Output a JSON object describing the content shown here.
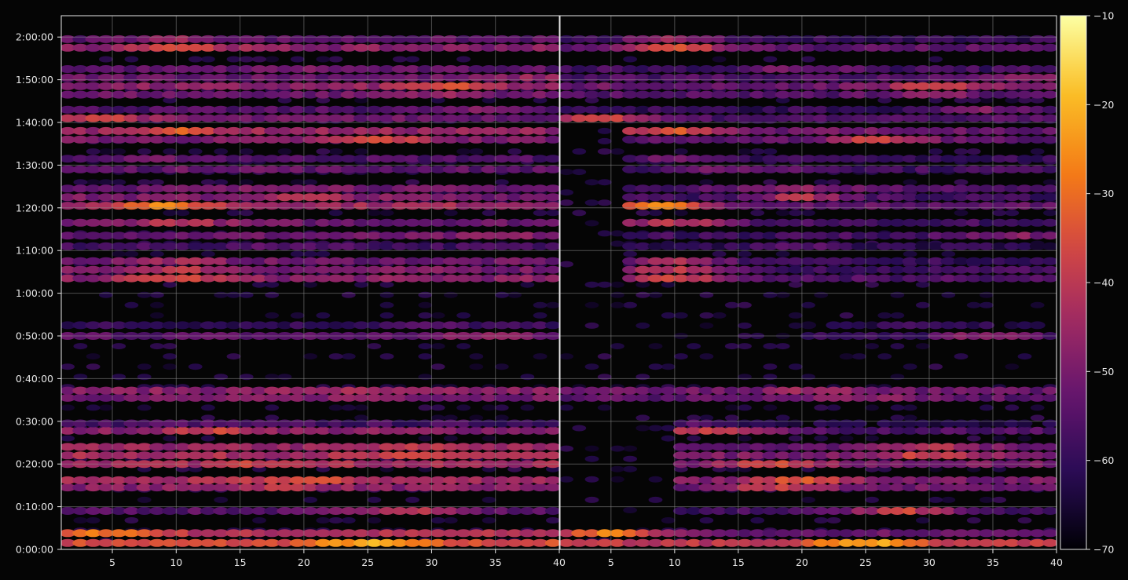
{
  "chart_data": {
    "type": "heatmap",
    "background": "#050505",
    "grid": true,
    "grid_color": "#8a8a8a",
    "panels": [
      {
        "name": "left",
        "x_tick_labels": [
          "5",
          "10",
          "15",
          "20",
          "25",
          "30",
          "35",
          "40"
        ],
        "xlim": [
          1,
          40
        ]
      },
      {
        "name": "right",
        "x_tick_labels": [
          "5",
          "10",
          "15",
          "20",
          "25",
          "30",
          "35",
          "40"
        ],
        "xlim": [
          1,
          40
        ]
      }
    ],
    "y_tick_labels": [
      "0:00:00",
      "0:10:00",
      "0:20:00",
      "0:30:00",
      "0:40:00",
      "0:50:00",
      "1:00:00",
      "1:10:00",
      "1:20:00",
      "1:30:00",
      "1:40:00",
      "1:50:00",
      "2:00:00"
    ],
    "ylim_minutes": [
      0,
      125
    ],
    "colorbar": {
      "colormap": "inferno",
      "range": [
        -70,
        -10
      ],
      "tick_labels": [
        "−10",
        "−20",
        "−30",
        "−40",
        "−50",
        "−60",
        "−70"
      ],
      "tick_values": [
        -10,
        -20,
        -30,
        -40,
        -50,
        -60,
        -70
      ]
    },
    "bands": [
      {
        "minute": 1.5,
        "left": -36,
        "right": -40,
        "peak_x": 25,
        "peak": -22
      },
      {
        "minute": 3.8,
        "left": -42,
        "right": -52,
        "peak_x": 5,
        "peak": -28
      },
      {
        "minute": 9.0,
        "left": -55,
        "right": -58,
        "peak_x": 28,
        "peak": -38
      },
      {
        "minute": 14.5,
        "left": -48,
        "right": -52,
        "peak_x": 18,
        "peak": -40
      },
      {
        "minute": 16.2,
        "left": -44,
        "right": -50,
        "peak_x": 20,
        "peak": -35
      },
      {
        "minute": 20.0,
        "left": -44,
        "right": -50,
        "peak_x": 18,
        "peak": -36
      },
      {
        "minute": 22.0,
        "left": -43,
        "right": -50,
        "peak_x": 30,
        "peak": -38
      },
      {
        "minute": 24.0,
        "left": -46,
        "right": -52,
        "peak_x": 30,
        "peak": -40
      },
      {
        "minute": 27.8,
        "left": -48,
        "right": -56,
        "peak_x": 13,
        "peak": -38
      },
      {
        "minute": 29.5,
        "left": -58,
        "right": -64,
        "peak_x": 10,
        "peak": -55
      },
      {
        "minute": 35.5,
        "left": -50,
        "right": -54,
        "peak_x": 25,
        "peak": -46
      },
      {
        "minute": 37.2,
        "left": -48,
        "right": -52,
        "peak_x": 22,
        "peak": -44
      },
      {
        "minute": 50.0,
        "left": -54,
        "right": -60,
        "peak_x": 35,
        "peak": -46
      },
      {
        "minute": 52.5,
        "left": -60,
        "right": -66,
        "peak_x": 30,
        "peak": -56
      },
      {
        "minute": 63.5,
        "left": -48,
        "right": -56,
        "peak_x": 10,
        "peak": -36
      },
      {
        "minute": 65.5,
        "left": -50,
        "right": -58,
        "peak_x": 10,
        "peak": -40
      },
      {
        "minute": 67.5,
        "left": -52,
        "right": -60,
        "peak_x": 10,
        "peak": -44
      },
      {
        "minute": 71.0,
        "left": -58,
        "right": -62,
        "peak_x": 20,
        "peak": -54
      },
      {
        "minute": 73.5,
        "left": -52,
        "right": -58,
        "peak_x": 36,
        "peak": -48
      },
      {
        "minute": 76.5,
        "left": -52,
        "right": -58,
        "peak_x": 10,
        "peak": -40
      },
      {
        "minute": 80.5,
        "left": -44,
        "right": -54,
        "peak_x": 9,
        "peak": -28
      },
      {
        "minute": 82.5,
        "left": -50,
        "right": -58,
        "peak_x": 20,
        "peak": -42
      },
      {
        "minute": 84.5,
        "left": -52,
        "right": -56,
        "peak_x": 20,
        "peak": -46
      },
      {
        "minute": 89.0,
        "left": -54,
        "right": -58,
        "peak_x": 15,
        "peak": -50
      },
      {
        "minute": 91.5,
        "left": -56,
        "right": -60,
        "peak_x": 10,
        "peak": -52
      },
      {
        "minute": 96.0,
        "left": -50,
        "right": -54,
        "peak_x": 26,
        "peak": -36
      },
      {
        "minute": 98.0,
        "left": -46,
        "right": -52,
        "peak_x": 10,
        "peak": -34
      },
      {
        "minute": 101.0,
        "left": -52,
        "right": -56,
        "peak_x": 4,
        "peak": -36
      },
      {
        "minute": 103.0,
        "left": -56,
        "right": -60,
        "peak_x": 35,
        "peak": -50
      },
      {
        "minute": 106.5,
        "left": -52,
        "right": -56,
        "peak_x": 30,
        "peak": -46
      },
      {
        "minute": 108.5,
        "left": -48,
        "right": -52,
        "peak_x": 31,
        "peak": -36
      },
      {
        "minute": 110.5,
        "left": -52,
        "right": -56,
        "peak_x": 39,
        "peak": -46
      },
      {
        "minute": 112.5,
        "left": -54,
        "right": -58,
        "peak_x": 20,
        "peak": -50
      },
      {
        "minute": 117.5,
        "left": -48,
        "right": -54,
        "peak_x": 10,
        "peak": -34
      },
      {
        "minute": 119.5,
        "left": -54,
        "right": -60,
        "peak_x": 10,
        "peak": -46
      }
    ],
    "right_panel_silent_until_minute": 58
  }
}
